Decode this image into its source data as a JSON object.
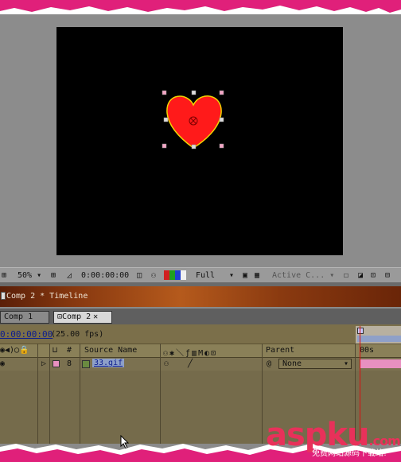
{
  "viewer": {
    "zoom": "50%",
    "timecode": "0:00:00:00",
    "resolution": "Full",
    "camera": "Active C..."
  },
  "timeline": {
    "title": "Comp 2 * Timeline",
    "tabs": [
      {
        "label": "Comp 1"
      },
      {
        "label": "Comp 2"
      }
    ],
    "current_time": "0:00:00:00",
    "fps": "(25.00 fps)",
    "columns": {
      "number": "#",
      "source_name": "Source Name",
      "parent": "Parent",
      "ruler_start": "00s"
    },
    "layers": [
      {
        "number": "8",
        "source_name": "33.gif",
        "parent": "None"
      }
    ]
  },
  "watermark": {
    "logo": "aspku",
    "domain_suffix": ".com",
    "tagline": "免费网站源码下载站!"
  },
  "colors": {
    "torn_edge": "#e0207a",
    "heart_fill": "#ff1a1a",
    "heart_outline": "#f2d400",
    "label_pink": "#e890c0",
    "watermark": "#e8315a"
  }
}
